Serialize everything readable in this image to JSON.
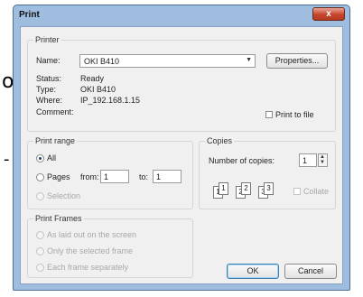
{
  "background": {
    "left_glyph": "o",
    "left_dash": "-"
  },
  "window": {
    "title": "Print",
    "close_glyph": "x",
    "colors": {
      "title_bar": "#9fbedf",
      "close": "#c5452b",
      "client": "#f0f0f0"
    }
  },
  "printer": {
    "group_label": "Printer",
    "name_label": "Name:",
    "name_value": "OKI B410",
    "properties_label": "Properties...",
    "status_label": "Status:",
    "status_value": "Ready",
    "type_label": "Type:",
    "type_value": "OKI B410",
    "where_label": "Where:",
    "where_value": "IP_192.168.1.15",
    "comment_label": "Comment:",
    "comment_value": "",
    "print_to_file_label": "Print to file"
  },
  "print_range": {
    "group_label": "Print range",
    "all_label": "All",
    "pages_label": "Pages",
    "from_label": "from:",
    "from_value": "1",
    "to_label": "to:",
    "to_value": "1",
    "selection_label": "Selection",
    "selected": "all"
  },
  "copies": {
    "group_label": "Copies",
    "number_label": "Number of copies:",
    "number_value": "1",
    "collate_label": "Collate",
    "collate_pages": [
      "1",
      "1",
      "2",
      "2",
      "3",
      "3"
    ]
  },
  "print_frames": {
    "group_label": "Print Frames",
    "option_1": "As laid out on the screen",
    "option_2": "Only the selected frame",
    "option_3": "Each frame separately"
  },
  "buttons": {
    "ok_label": "OK",
    "cancel_label": "Cancel"
  }
}
